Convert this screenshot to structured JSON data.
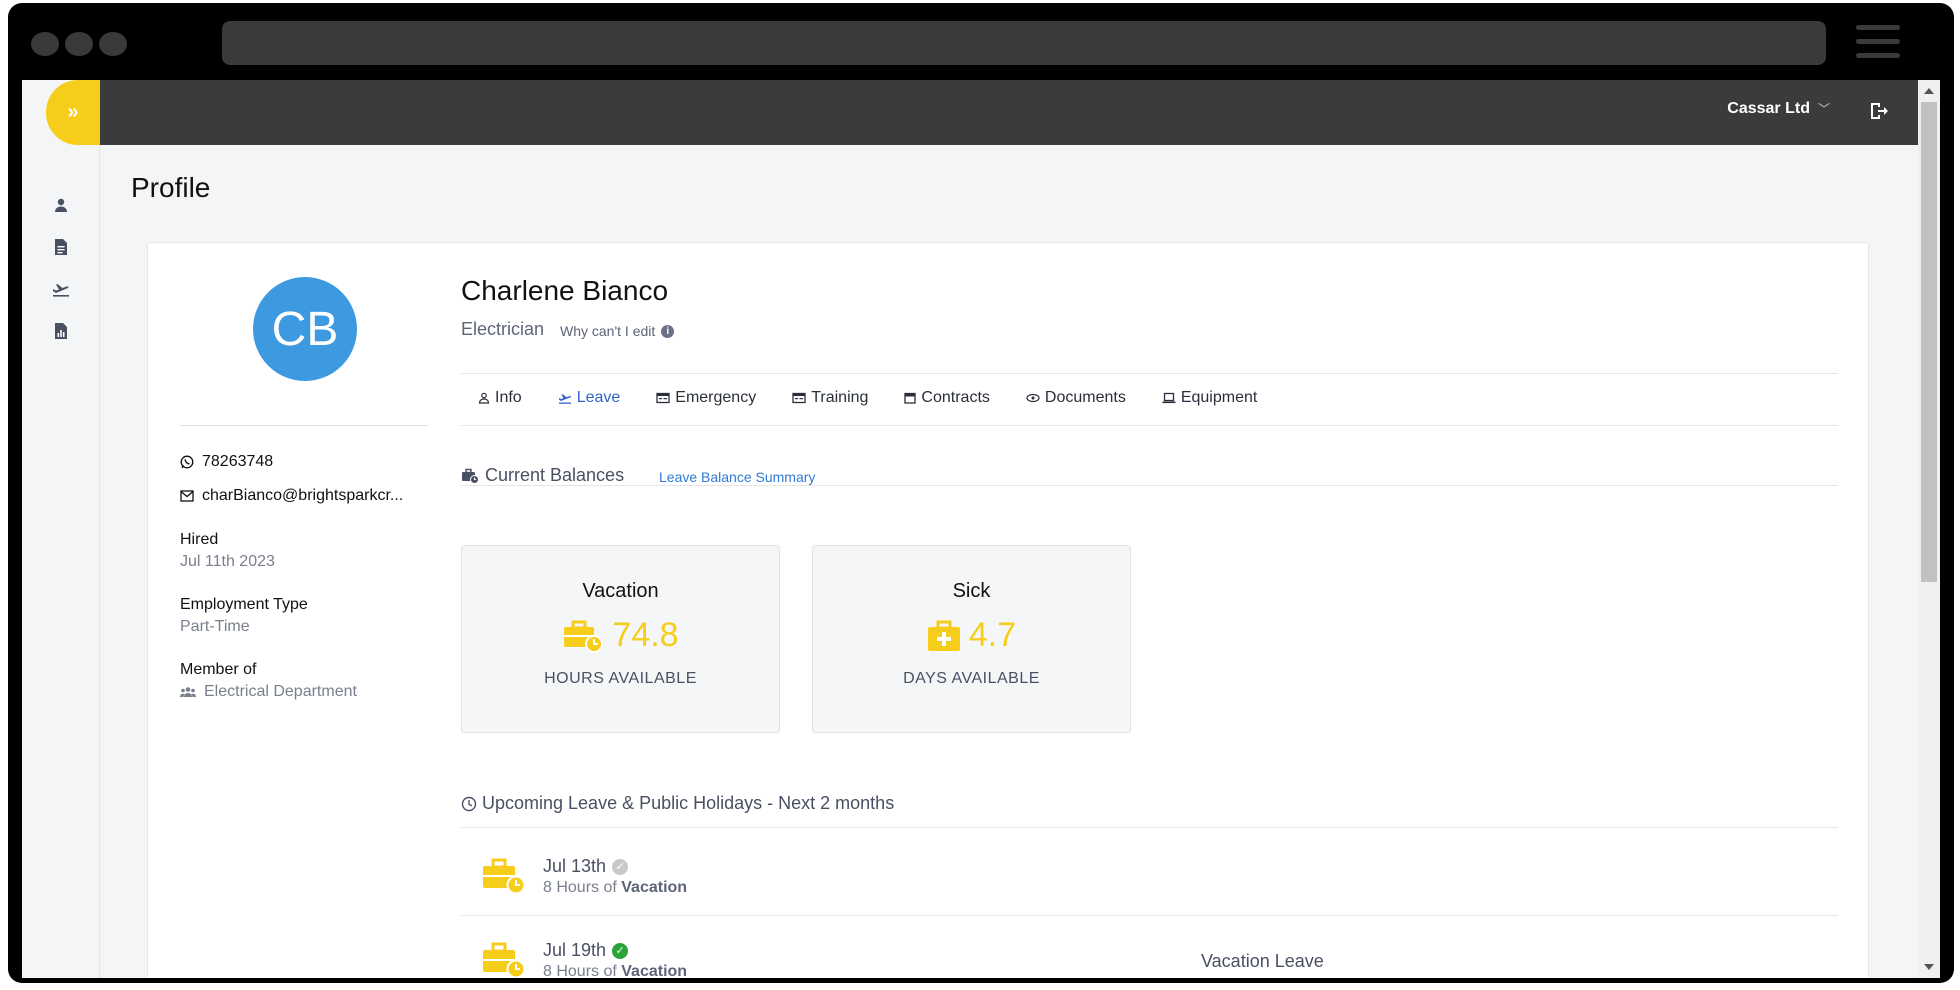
{
  "app": {
    "company_name": "Cassar Ltd",
    "page_title": "Profile",
    "accent_color": "#f7cd1c",
    "link_color": "#2f7bd6"
  },
  "sidebar": {
    "toggle_icon": "double-chevron-right-icon",
    "items": [
      {
        "icon": "person-icon"
      },
      {
        "icon": "document-icon"
      },
      {
        "icon": "airplane-departure-icon"
      },
      {
        "icon": "report-chart-icon"
      }
    ]
  },
  "profile": {
    "initials": "CB",
    "avatar_color": "#3d9ae0",
    "name": "Charlene Bianco",
    "role": "Electrician",
    "why_cant_edit": "Why can't I edit",
    "phone": "78263748",
    "email": "charBianco@brightsparkcr...",
    "hired_label": "Hired",
    "hired_value": "Jul 11th 2023",
    "employment_type_label": "Employment Type",
    "employment_type_value": "Part-Time",
    "member_of_label": "Member of",
    "member_of_value": "Electrical Department"
  },
  "tabs": [
    {
      "label": "Info",
      "icon": "person-icon",
      "active": false
    },
    {
      "label": "Leave",
      "icon": "airplane-departure-icon",
      "active": true
    },
    {
      "label": "Emergency",
      "icon": "id-card-icon",
      "active": false
    },
    {
      "label": "Training",
      "icon": "id-card-icon",
      "active": false
    },
    {
      "label": "Contracts",
      "icon": "calendar-icon",
      "active": false
    },
    {
      "label": "Documents",
      "icon": "eye-icon",
      "active": false
    },
    {
      "label": "Equipment",
      "icon": "laptop-icon",
      "active": false
    }
  ],
  "balances": {
    "heading": "Current Balances",
    "summary_link": "Leave Balance Summary",
    "tiles": [
      {
        "title": "Vacation",
        "value": "74.8",
        "unit": "HOURS AVAILABLE",
        "icon": "briefcase-clock-icon"
      },
      {
        "title": "Sick",
        "value": "4.7",
        "unit": "DAYS AVAILABLE",
        "icon": "medical-briefcase-icon"
      }
    ]
  },
  "upcoming": {
    "heading": "Upcoming Leave & Public Holidays - Next 2 months",
    "items": [
      {
        "date": "Jul 13th",
        "hours_prefix": "8 Hours of",
        "type": "Vacation",
        "status": "pending",
        "note": ""
      },
      {
        "date": "Jul 19th",
        "hours_prefix": "8 Hours of",
        "type": "Vacation",
        "status": "approved",
        "note": "Vacation Leave"
      }
    ]
  }
}
